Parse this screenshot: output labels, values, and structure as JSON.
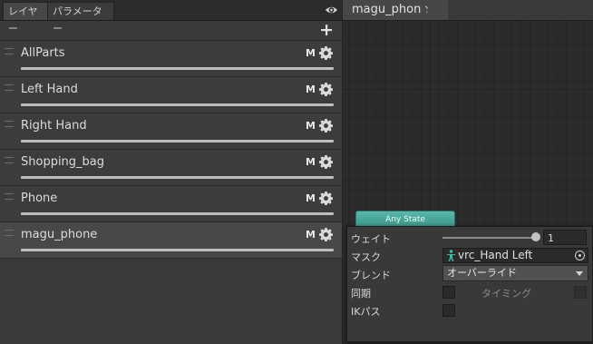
{
  "left_panel": {
    "tabs": [
      "レイヤー",
      "パラメーター"
    ],
    "visibility_icon": "eye-icon",
    "add_icon": "plus-icon",
    "layers": [
      {
        "name": "AllParts",
        "mute_label": "M",
        "selected": false
      },
      {
        "name": "Left Hand",
        "mute_label": "M",
        "selected": false
      },
      {
        "name": "Right Hand",
        "mute_label": "M",
        "selected": false
      },
      {
        "name": "Shopping_bag",
        "mute_label": "M",
        "selected": false
      },
      {
        "name": "Phone",
        "mute_label": "M",
        "selected": false
      },
      {
        "name": "magu_phone",
        "mute_label": "M",
        "selected": true
      }
    ]
  },
  "graph": {
    "breadcrumb": "magu_phone",
    "any_state_label": "Any State",
    "any_state_color": "#4aa597"
  },
  "layer_settings": {
    "weight_label": "ウェイト",
    "weight_value": "1",
    "weight_slider_fraction": 1.0,
    "mask_label": "マスク",
    "mask_value": "vrc_Hand Left",
    "blend_label": "ブレンド",
    "blend_value": "オーバーライド",
    "sync_label": "同期",
    "timing_label": "タイミング",
    "ik_label": "IKパス"
  }
}
